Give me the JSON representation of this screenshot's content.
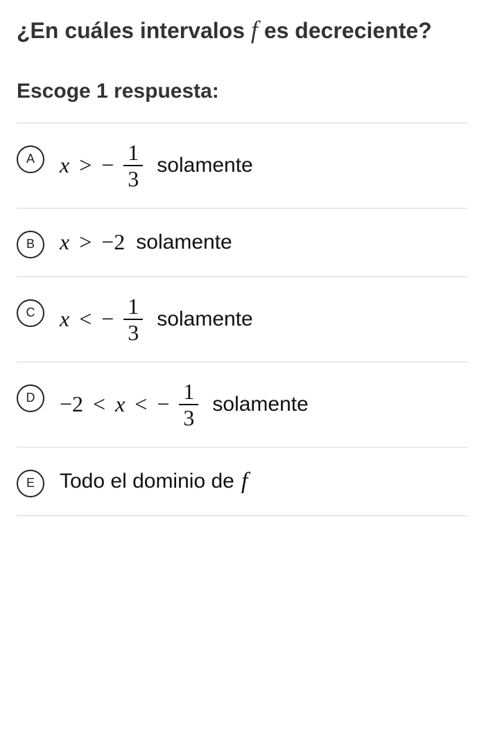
{
  "question": {
    "prefix": "¿En cuáles intervalos ",
    "func": "f",
    "suffix": " es decreciente?"
  },
  "instruction": "Escoge 1 respuesta:",
  "choices": {
    "a": {
      "letter": "A",
      "var": "x",
      "rel": ">",
      "neg": "−",
      "frac_num": "1",
      "frac_den": "3",
      "word": "solamente"
    },
    "b": {
      "letter": "B",
      "var": "x",
      "rel": ">",
      "value": "−2",
      "word": "solamente"
    },
    "c": {
      "letter": "C",
      "var": "x",
      "rel": "<",
      "neg": "−",
      "frac_num": "1",
      "frac_den": "3",
      "word": "solamente"
    },
    "d": {
      "letter": "D",
      "left": "−2",
      "rel1": "<",
      "var": "x",
      "rel2": "<",
      "neg": "−",
      "frac_num": "1",
      "frac_den": "3",
      "word": "solamente"
    },
    "e": {
      "letter": "E",
      "text": "Todo el dominio de ",
      "func": "f"
    }
  }
}
